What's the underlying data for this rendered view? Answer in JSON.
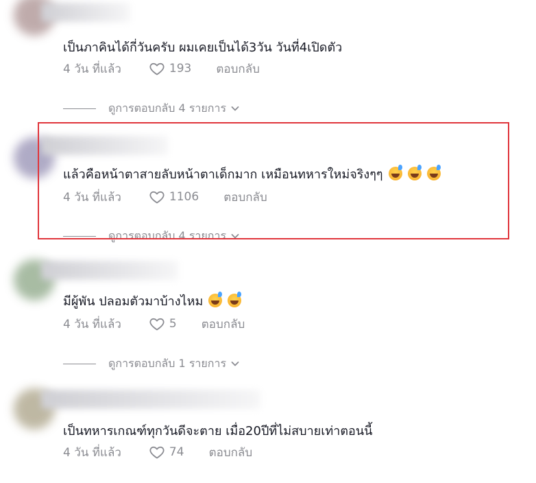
{
  "comments": [
    {
      "text": "เป็นภาคินได้กี่วันครับ ผมเคยเป็นได้3วัน วันที่4เปิดตัว",
      "emoji_count": 0,
      "time": "4 วัน ที่แล้ว",
      "likes": "193",
      "reply_label": "ตอบกลับ",
      "view_replies": "ดูการตอบกลับ 4 รายการ",
      "avatar_color": "#b9a3a3"
    },
    {
      "text": "แล้วคือหน้าตาสายลับหน้าตาเด็กมาก เหมือนทหารใหม่จริงๆๆ",
      "emoji_count": 3,
      "time": "4 วัน ที่แล้ว",
      "likes": "1106",
      "reply_label": "ตอบกลับ",
      "view_replies": "ดูการตอบกลับ 4 รายการ",
      "avatar_color": "#a7a2c0",
      "highlighted": true
    },
    {
      "text": "มีผู้พัน ปลอมตัวมาบ้างไหม",
      "emoji_count": 2,
      "time": "4 วัน ที่แล้ว",
      "likes": "5",
      "reply_label": "ตอบกลับ",
      "view_replies": "ดูการตอบกลับ 1 รายการ",
      "avatar_color": "#9fb59a"
    },
    {
      "text": "เป็นทหารเกณฑ์ทุกวันดีจะตาย เมื่อ20ปีที่ไม่สบายเท่าตอนนี้",
      "emoji_count": 0,
      "time": "4 วัน ที่แล้ว",
      "likes": "74",
      "reply_label": "ตอบกลับ",
      "view_replies": "",
      "avatar_color": "#b8b19a"
    }
  ],
  "colors": {
    "text": "#161823",
    "muted": "#8a8b91",
    "highlight_border": "#e0343b"
  },
  "icons": {
    "like": "heart-outline-icon",
    "expand": "chevron-down-icon",
    "emoji": "grinning-sweat-emoji"
  }
}
